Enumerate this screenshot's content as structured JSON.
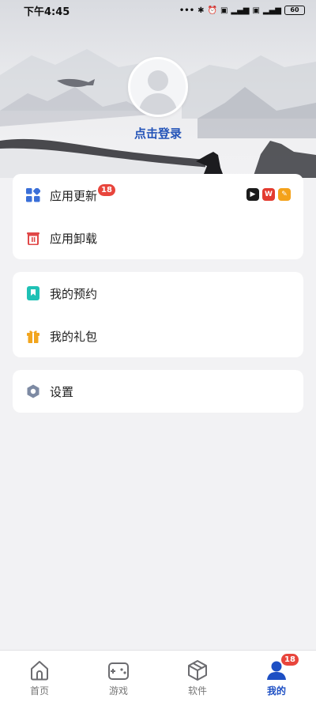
{
  "status_bar": {
    "time": "下午4:45",
    "icons": [
      "more-dots-icon",
      "bluetooth-icon",
      "alarm-icon",
      "hd-icon",
      "signal-4g-icon",
      "hd-icon",
      "signal-4g-icon"
    ],
    "battery": "60"
  },
  "profile": {
    "login_label": "点击登录"
  },
  "menu_group_1": {
    "items": [
      {
        "label": "应用更新",
        "icon": "app-update-icon",
        "badge": "18",
        "app_icons": [
          "video-app-icon",
          "wps-app-icon",
          "orange-app-icon"
        ]
      },
      {
        "label": "应用卸载",
        "icon": "trash-icon"
      }
    ]
  },
  "menu_group_2": {
    "items": [
      {
        "label": "我的预约",
        "icon": "bookmark-icon"
      },
      {
        "label": "我的礼包",
        "icon": "gift-icon"
      }
    ]
  },
  "menu_group_3": {
    "items": [
      {
        "label": "设置",
        "icon": "settings-hexagon-icon"
      }
    ]
  },
  "bottom_nav": {
    "items": [
      {
        "label": "首页",
        "icon": "home-icon",
        "active": false
      },
      {
        "label": "游戏",
        "icon": "gamepad-icon",
        "active": false
      },
      {
        "label": "软件",
        "icon": "cube-icon",
        "active": false
      },
      {
        "label": "我的",
        "icon": "user-icon",
        "active": true,
        "badge": "18"
      }
    ]
  },
  "colors": {
    "accent": "#1d4fc4",
    "login_text": "#2454b8",
    "badge": "#e8453c",
    "page_background": "#f2f2f4",
    "card_background": "#ffffff"
  }
}
